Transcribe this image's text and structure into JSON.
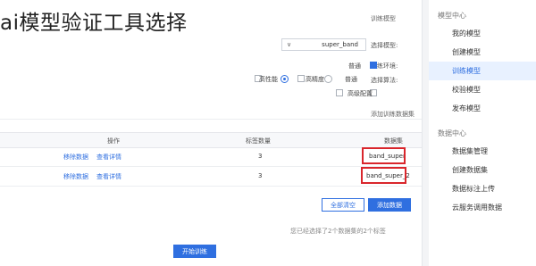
{
  "overlay_title": "ai模型验证工具选择",
  "sidebar": {
    "section1": "模型中心",
    "items1": [
      "我的模型",
      "创建模型",
      "训练模型",
      "校验模型",
      "发布模型"
    ],
    "active_index": 2,
    "section2": "数据中心",
    "items2": [
      "数据集管理",
      "创建数据集",
      "数据标注上传",
      "云服务调用数据"
    ]
  },
  "main": {
    "header": "训练模型",
    "model_label": "选择模型:",
    "model_value": "super_band",
    "env_label": "训练环境:",
    "env_option": "普通",
    "method_label": "选择算法:",
    "method_options": [
      "普通",
      "高精度",
      "高性能"
    ],
    "method_checked_index": 2,
    "extra_label": "高级配置",
    "dataset_section": "添加训练数据集",
    "table_headers": [
      "数据集",
      "标签数量",
      "操作"
    ],
    "rows": [
      {
        "name": "band_super",
        "count": "3",
        "action1": "查看详情",
        "action2": "移除数据"
      },
      {
        "name": "band_super_2",
        "count": "3",
        "action1": "查看详情",
        "action2": "移除数据"
      }
    ],
    "add_button": "添加数据",
    "clear_button": "全部清空",
    "hint_text": "您已经选择了2个数据集的2个标签",
    "submit_button": "开始训练"
  }
}
